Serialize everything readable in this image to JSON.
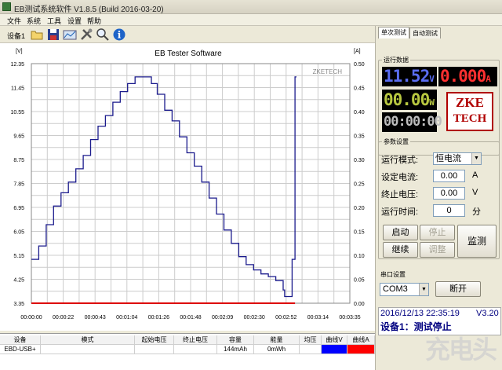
{
  "window": {
    "title": "EB测试系统软件 V1.8.5 (Build 2016-03-20)"
  },
  "menu": [
    "文件",
    "系统",
    "工具",
    "设置",
    "帮助"
  ],
  "toolbar": {
    "device_label": "设备1",
    "icons": [
      "folder-open-icon",
      "save-icon",
      "chart-icon",
      "tools-icon",
      "zoom-icon",
      "info-icon"
    ]
  },
  "chart": {
    "title": "EB Tester Software",
    "watermark": "ZKETECH",
    "left_unit": "[V]",
    "right_unit": "[A]",
    "left_ticks": [
      "12.35",
      "11.45",
      "10.55",
      "9.65",
      "8.75",
      "7.85",
      "6.95",
      "6.05",
      "5.15",
      "4.25",
      "3.35"
    ],
    "right_ticks": [
      "0.50",
      "0.45",
      "0.40",
      "0.35",
      "0.30",
      "0.25",
      "0.20",
      "0.15",
      "0.10",
      "0.05",
      "0.00"
    ],
    "x_ticks": [
      "00:00:00",
      "00:00:22",
      "00:00:43",
      "00:01:04",
      "00:01:26",
      "00:01:48",
      "00:02:09",
      "00:02:30",
      "00:02:52",
      "00:03:14",
      "00:03:35"
    ],
    "colors": {
      "voltage": "#1a1a8c",
      "current": "#dd0000",
      "grid": "#cccccc"
    }
  },
  "chart_data": {
    "type": "line",
    "title": "EB Tester Software",
    "xlabel": "",
    "ylabel": "[V]",
    "y2label": "[A]",
    "ylim": [
      3.35,
      12.35
    ],
    "y2lim": [
      0,
      0.5
    ],
    "xlim_seconds": [
      0,
      215
    ],
    "grid": true,
    "series": [
      {
        "name": "曲线V",
        "axis": "left",
        "x": [
          0,
          5,
          10,
          15,
          20,
          25,
          30,
          35,
          40,
          45,
          50,
          55,
          60,
          65,
          70,
          75,
          80,
          81,
          85,
          90,
          95,
          100,
          105,
          110,
          115,
          120,
          125,
          130,
          135,
          140,
          145,
          150,
          155,
          160,
          165,
          170,
          171,
          175,
          176,
          178,
          179
        ],
        "y": [
          5.0,
          5.5,
          6.3,
          7.0,
          7.5,
          7.9,
          8.4,
          8.9,
          9.5,
          10.0,
          10.4,
          10.9,
          11.3,
          11.6,
          11.85,
          11.85,
          11.85,
          11.6,
          11.2,
          10.6,
          10.2,
          9.6,
          9.0,
          8.5,
          7.9,
          7.3,
          6.7,
          6.1,
          5.6,
          5.1,
          4.8,
          4.6,
          4.45,
          4.35,
          4.2,
          3.85,
          3.6,
          3.6,
          5.0,
          11.85,
          11.85
        ]
      },
      {
        "name": "曲线A",
        "axis": "right",
        "x": [
          0,
          178
        ],
        "y": [
          0.0,
          0.0
        ]
      }
    ]
  },
  "table": {
    "headers": [
      "设备",
      "模式",
      "起始电压",
      "终止电压",
      "容量",
      "能量",
      "均压",
      "曲线V",
      "曲线A"
    ],
    "row": [
      "EBD-USB+",
      "",
      "",
      "",
      "144mAh",
      "0mWh",
      "",
      "",
      ""
    ],
    "curve_v_color": "#0000ff",
    "curve_a_color": "#ff0000"
  },
  "right": {
    "tabs": [
      "单次测试",
      "自动测试"
    ],
    "running_group": "运行数据",
    "voltage": "11.52",
    "voltage_unit": "V",
    "current": "0.000",
    "current_unit": "A",
    "power": "00.00",
    "power_unit": "W",
    "time": "00:00:00",
    "logo_top": "ZKE",
    "logo_bottom": "TECH",
    "param_group": "参数设置",
    "mode_label": "运行模式:",
    "mode_value": "恒电流",
    "current_label": "设定电流:",
    "current_value": "0.00",
    "current_set_unit": "A",
    "stop_label": "终止电压:",
    "stop_value": "0.00",
    "stop_unit": "V",
    "runtime_label": "运行时间:",
    "runtime_value": "0",
    "runtime_unit": "分",
    "btn_start": "启动",
    "btn_stop": "停止",
    "btn_continue": "继续",
    "btn_adjust": "调整",
    "btn_monitor": "监测",
    "serial_group": "串口设置",
    "com_value": "COM3",
    "btn_disconnect": "断开",
    "status_time": "2016/12/13 22:35:19",
    "status_version": "V3.20",
    "status_text": "设备1：测试停止"
  },
  "watermark": "充电头"
}
